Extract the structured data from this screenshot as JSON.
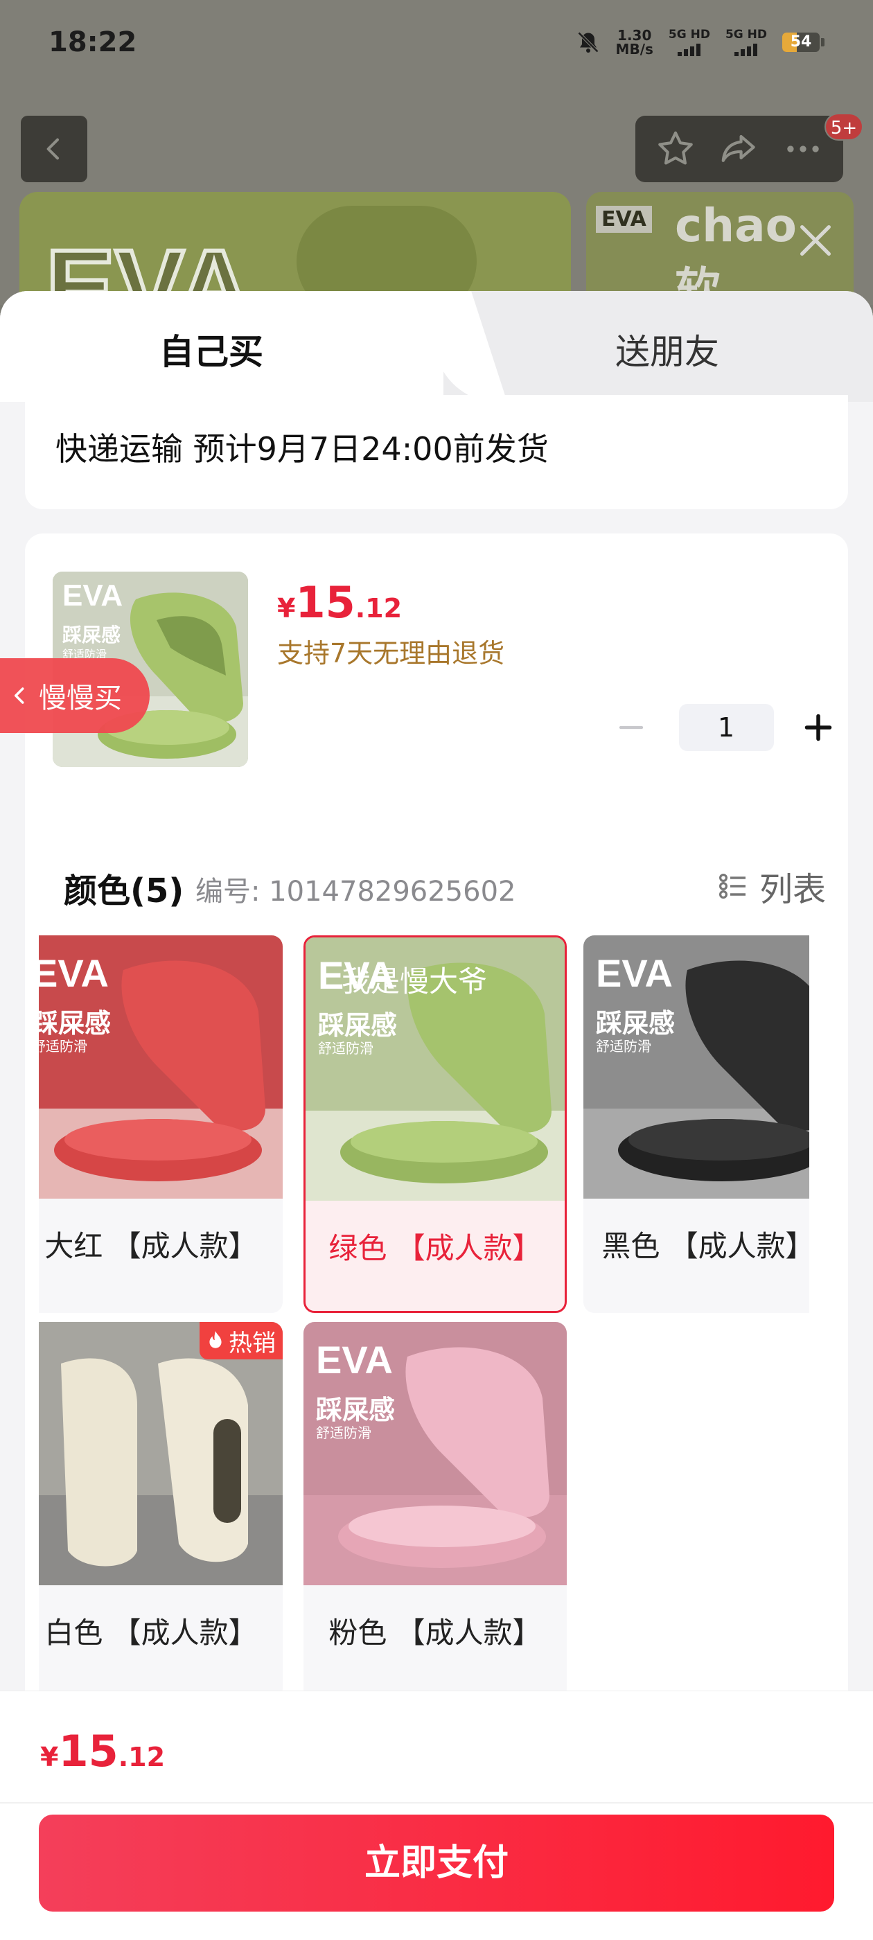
{
  "status_bar": {
    "time": "18:22",
    "net_speed_value": "1.30",
    "net_speed_unit": "MB/s",
    "sig1": "5G HD",
    "sig2": "5G HD",
    "battery": "54"
  },
  "background_page": {
    "cart_badge": "5+",
    "hero_text": "EVA",
    "thumb_tag": "EVA",
    "thumb_text": "chao 软"
  },
  "tabs": {
    "buy_self": "自己买",
    "gift_friend": "送朋友"
  },
  "shipping": {
    "text": "快递运输 预计9月7日24:00前发货"
  },
  "product": {
    "price_symbol": "¥",
    "price_int": "15",
    "price_dec": ".12",
    "return_policy": "支持7天无理由退货",
    "quantity": "1",
    "thumb_logo": "EVA",
    "thumb_sub": "踩屎感",
    "thumb_sub2": "舒适防滑"
  },
  "slow_buy": {
    "label": "慢慢买"
  },
  "colors": {
    "title": "颜色(5)",
    "sku": "编号: 10147829625602",
    "list_label": "列表",
    "items": [
      {
        "label": "大红 【成人款】",
        "bg": "#d9514f",
        "floor": "#e6b6b4",
        "logo": "EVA",
        "sub": "踩屎感",
        "sub2": "舒适防滑"
      },
      {
        "label": "绿色 【成人款】",
        "bg": "#a5c36d",
        "floor": "#dfe5cf",
        "logo": "EVA",
        "sub": "踩屎感",
        "sub2": "舒适防滑",
        "watermark": "我是慢大爷"
      },
      {
        "label": "黑色 【成人款】",
        "bg": "#2d2d2d",
        "floor": "#a9a9a9",
        "logo": "EVA",
        "sub": "踩屎感",
        "sub2": "舒适防滑"
      },
      {
        "label": "白色 【成人款】",
        "bg": "#ece6d3",
        "floor": "#8c8b89",
        "hot": "热销"
      },
      {
        "label": "粉色 【成人款】",
        "bg": "#efb7c6",
        "floor": "#d69aa9",
        "logo": "EVA",
        "sub": "踩屎感",
        "sub2": "舒适防滑"
      }
    ]
  },
  "footer": {
    "price_symbol": "¥",
    "price_int": "15",
    "price_dec": ".12",
    "pay_label": "立即支付"
  },
  "accent_color": "#e8223a"
}
